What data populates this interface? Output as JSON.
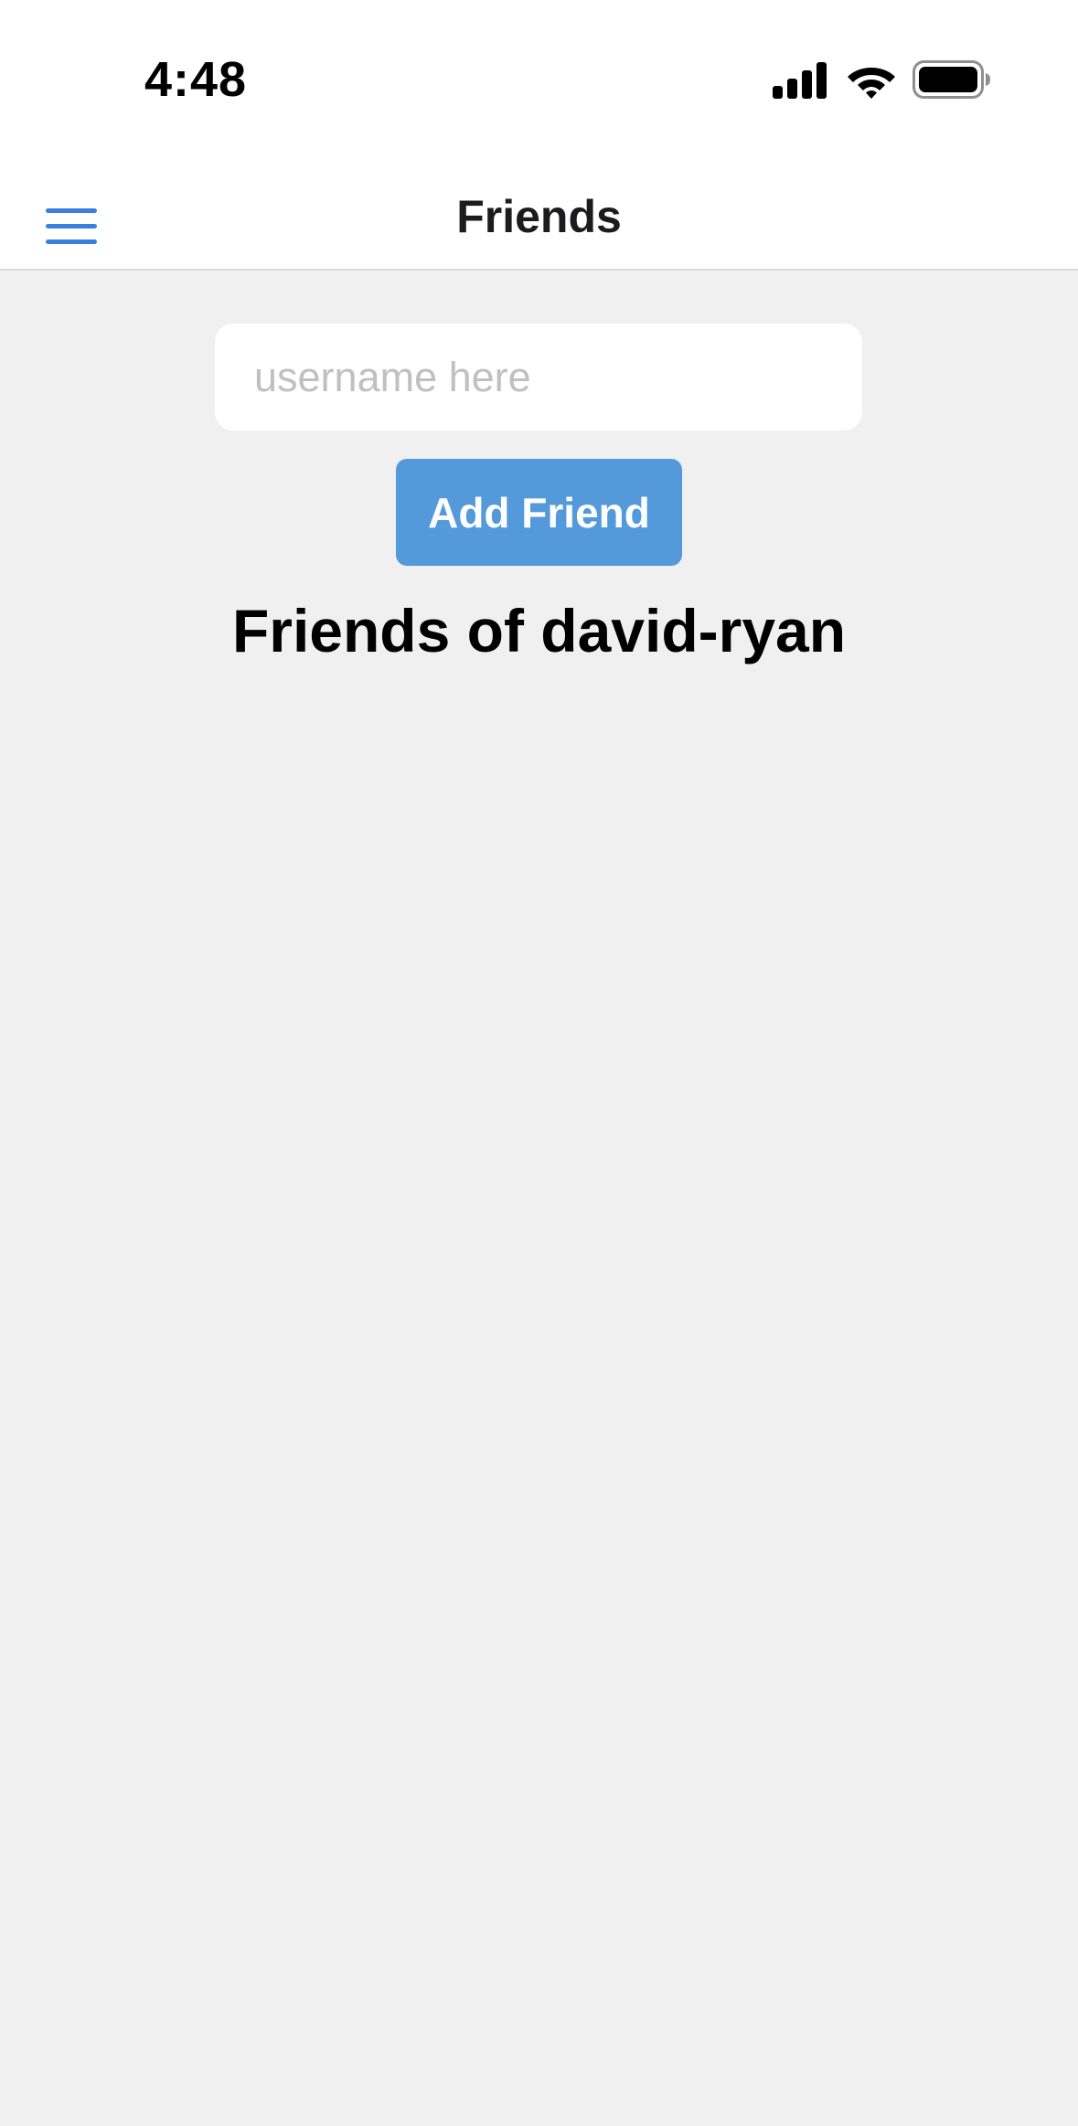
{
  "status_bar": {
    "time": "4:48",
    "icons": [
      "signal-icon",
      "wifi-icon",
      "battery-icon"
    ]
  },
  "nav": {
    "title": "Friends",
    "menu_icon": "hamburger-menu-icon"
  },
  "form": {
    "username_placeholder": "username here",
    "username_value": "",
    "add_button_label": "Add Friend"
  },
  "friends": {
    "heading": "Friends of david-ryan",
    "items": []
  },
  "colors": {
    "accent": "#3a7ee0",
    "button_bg": "#5499d9",
    "page_bg": "#f0f0f1"
  }
}
